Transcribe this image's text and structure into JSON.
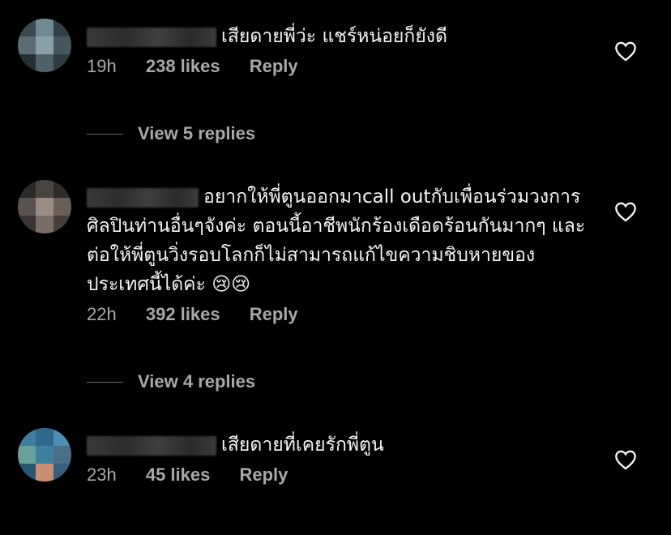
{
  "comments": [
    {
      "text": "เสียดายพี่ว่ะ แชร์หน่อยก็ยังดี",
      "time": "19h",
      "likes": "238 likes",
      "reply": "Reply"
    },
    {
      "text": "อยากให้พี่ตูนออกมาcall outกับเพื่อนร่วมวงการศิลปินท่านอื่นๆจังค่ะ ตอนนี้อาชีพนักร้องเดือดร้อนกันมากๆ และต่อให้พี่ตูนวิ่งรอบโลกก็ไม่สามารถแก้ไขความชิบหายของประเทศนี้ได้ค่ะ 😢😢",
      "time": "22h",
      "likes": "392 likes",
      "reply": "Reply"
    },
    {
      "text": "เสียดายที่เคยรักพี่ตูน",
      "time": "23h",
      "likes": "45 likes",
      "reply": "Reply"
    }
  ],
  "view_replies": [
    "View 5 replies",
    "View 4 replies"
  ],
  "icons": {
    "like": "heart-outline-icon"
  },
  "colors": {
    "background": "#000000",
    "text": "#f5f5f5",
    "muted": "#a8a8a8"
  }
}
